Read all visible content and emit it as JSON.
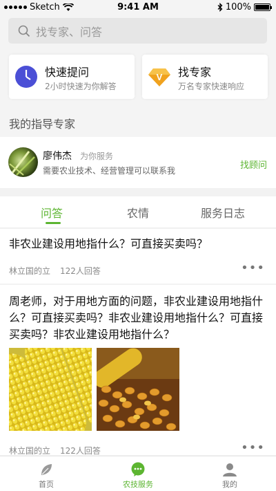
{
  "status_bar": {
    "carrier": "Sketch",
    "time": "9:41 AM",
    "battery": "100%"
  },
  "search": {
    "placeholder": "找专家、问答"
  },
  "quick_cards": [
    {
      "title": "快速提问",
      "subtitle": "2小时快速为你解答",
      "icon": "clock-icon"
    },
    {
      "title": "找专家",
      "subtitle": "万名专家快速响应",
      "icon": "v-badge-icon"
    }
  ],
  "section": {
    "title": "我的指导专家"
  },
  "expert": {
    "name": "廖伟杰",
    "role": "为你服务",
    "description": "需要农业技术、经营管理可以联系我",
    "action": "找顾问"
  },
  "tabs": [
    {
      "label": "问答",
      "active": true
    },
    {
      "label": "农情",
      "active": false
    },
    {
      "label": "服务日志",
      "active": false
    }
  ],
  "posts": [
    {
      "question": "非农业建设用地指什么？可直接买卖吗？",
      "author": "林立国的立",
      "answers": "122人回答"
    },
    {
      "question": "周老师，对于用地方面的问题，非农业建设用地指什么？可直接买卖吗？非农业建设用地指什么？可直接买卖吗？非农业建设用地指什么？",
      "author": "林立国的立",
      "answers": "122人回答",
      "images": [
        "corn-cobs-image",
        "corn-kernels-image"
      ]
    }
  ],
  "tab_bar": [
    {
      "label": "首页",
      "icon": "leaf-icon",
      "active": false
    },
    {
      "label": "农技服务",
      "icon": "chat-bubble-icon",
      "active": true
    },
    {
      "label": "我的",
      "icon": "person-icon",
      "active": false
    }
  ],
  "colors": {
    "accent": "#5cb531",
    "clock": "#4b4fd6",
    "badge": "#f0a21e"
  }
}
